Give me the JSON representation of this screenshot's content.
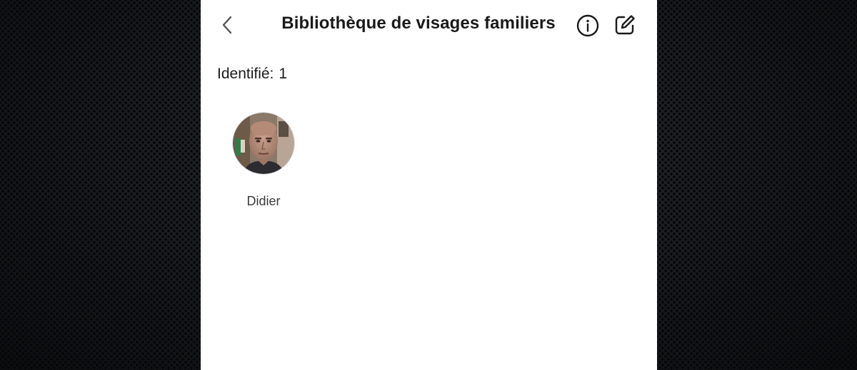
{
  "nav": {
    "title": "Bibliothèque de visages familiers",
    "back_icon": "chevron-left-icon",
    "info_icon": "info-circle-icon",
    "edit_icon": "edit-square-icon"
  },
  "summary": {
    "identified_label": "Identifié:",
    "identified_count": "1"
  },
  "faces": [
    {
      "name": "Didier",
      "avatar": "face-photo"
    }
  ],
  "colors": {
    "screen_background": "#ffffff",
    "text_primary": "#1a1a1a",
    "text_secondary": "#3a3a3a",
    "backdrop": "#16181b"
  }
}
